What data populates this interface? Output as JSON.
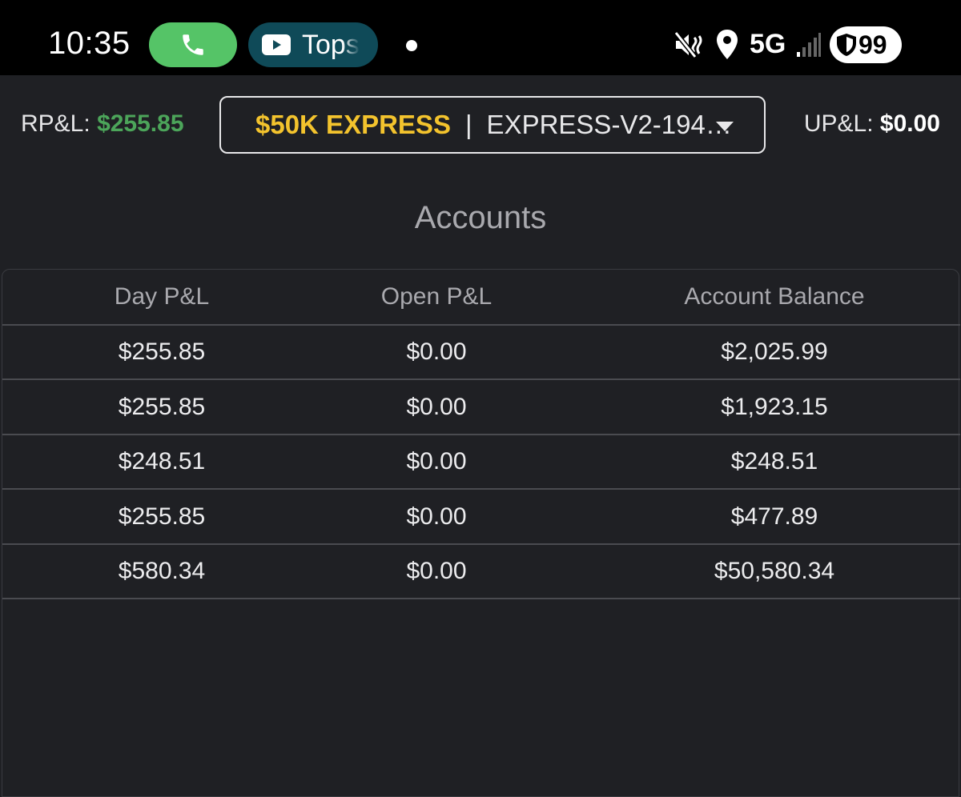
{
  "status_bar": {
    "time": "10:35",
    "media_text": "Tops",
    "network": "5G",
    "battery": "99",
    "icons": [
      "phone-icon",
      "youtube-icon",
      "mute-vibrate-icon",
      "location-icon",
      "signal-icon",
      "shield-icon"
    ],
    "colors": {
      "call_pill": "#55c467",
      "media_pill": "#0f4a58"
    }
  },
  "header": {
    "rpl_label": "RP&L:",
    "rpl_value": "$255.85",
    "upl_label": "UP&L:",
    "upl_value": "$0.00",
    "account_name": "$50K EXPRESS",
    "account_sep": "|",
    "account_id": "EXPRESS-V2-194…",
    "colors": {
      "rpl": "#4ca55a",
      "account_name": "#f3c32d"
    }
  },
  "accounts": {
    "title": "Accounts",
    "columns": [
      "Day P&L",
      "Open P&L",
      "Account Balance"
    ],
    "rows": [
      [
        "$255.85",
        "$0.00",
        "$2,025.99"
      ],
      [
        "$255.85",
        "$0.00",
        "$1,923.15"
      ],
      [
        "$248.51",
        "$0.00",
        "$248.51"
      ],
      [
        "$255.85",
        "$0.00",
        "$477.89"
      ],
      [
        "$580.34",
        "$0.00",
        "$50,580.34"
      ]
    ]
  }
}
